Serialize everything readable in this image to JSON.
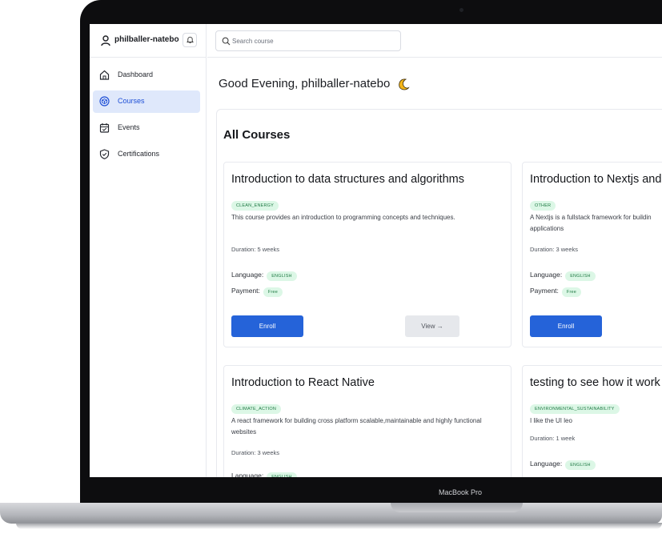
{
  "device": {
    "label": "MacBook Pro"
  },
  "sidebar": {
    "username": "philballer-natebo",
    "items": [
      {
        "label": "Dashboard",
        "icon": "home-icon",
        "active": false
      },
      {
        "label": "Courses",
        "icon": "cube-icon",
        "active": true
      },
      {
        "label": "Events",
        "icon": "calendar-icon",
        "active": false
      },
      {
        "label": "Certifications",
        "icon": "shield-check-icon",
        "active": false
      }
    ]
  },
  "search": {
    "placeholder": "Search course"
  },
  "main": {
    "greeting": "Good Evening, philballer-natebo",
    "greeting_icon": "moon-icon",
    "section_title": "All Courses"
  },
  "courses": [
    {
      "title": "Introduction to data structures and algorithms",
      "category": "CLEAN_ENERGY",
      "description": "This course provides an introduction to programming concepts and techniques.",
      "duration": "Duration: 5 weeks",
      "language_label": "Language:",
      "language": "ENGLISH",
      "payment_label": "Payment:",
      "payment": "Free",
      "enroll_label": "Enroll",
      "view_label": "View →"
    },
    {
      "title": "Introduction to Nextjs and ty",
      "category": "OTHER",
      "description": "A Nextjs is a fullstack framework for buildin applications",
      "duration": "Duration: 3 weeks",
      "language_label": "Language:",
      "language": "ENGLISH",
      "payment_label": "Payment:",
      "payment": "Free",
      "enroll_label": "Enroll"
    },
    {
      "title": "Introduction to React Native",
      "category": "CLIMATE_ACTION",
      "description": "A react framework for building cross platform scalable,maintainable and highly functional websites",
      "duration": "Duration: 3 weeks",
      "language_label": "Language:",
      "language": "ENGLISH"
    },
    {
      "title": "testing to see how it work",
      "category": "ENVIRONMENTAL_SUSTAINABILITY",
      "description": "I like the UI leo",
      "duration": "Duration: 1 week",
      "language_label": "Language:",
      "language": "ENGLISH"
    }
  ],
  "colors": {
    "primary": "#2563d9",
    "active_nav_bg": "#dfe8fb",
    "chip_bg": "#dcf7e6",
    "chip_text": "#1f7a44"
  }
}
